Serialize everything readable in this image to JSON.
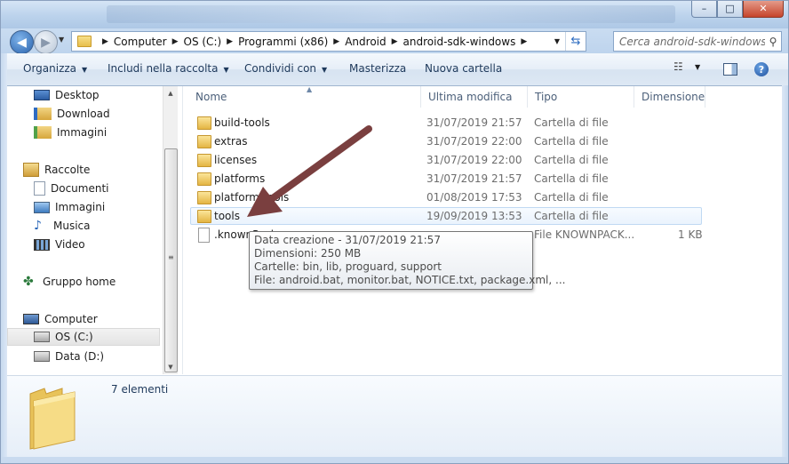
{
  "window": {
    "minimize": "–",
    "maximize": "□",
    "close": "✕"
  },
  "address": {
    "crumbs": [
      "Computer",
      "OS (C:)",
      "Programmi (x86)",
      "Android",
      "android-sdk-windows"
    ],
    "search_placeholder": "Cerca android-sdk-windows"
  },
  "toolbar": {
    "organize": "Organizza",
    "include": "Includi nella raccolta",
    "share": "Condividi con",
    "burn": "Masterizza",
    "new_folder": "Nuova cartella"
  },
  "nav": {
    "favorites": [
      "Desktop",
      "Download",
      "Immagini"
    ],
    "libraries_label": "Raccolte",
    "libraries": [
      "Documenti",
      "Immagini",
      "Musica",
      "Video"
    ],
    "homegroup": "Gruppo home",
    "computer": "Computer",
    "drives": [
      "OS (C:)",
      "Data (D:)"
    ]
  },
  "columns": {
    "name": "Nome",
    "modified": "Ultima modifica",
    "type": "Tipo",
    "size": "Dimensione"
  },
  "files": [
    {
      "name": "build-tools",
      "date": "31/07/2019 21:57",
      "type": "Cartella di file",
      "size": ""
    },
    {
      "name": "extras",
      "date": "31/07/2019 22:00",
      "type": "Cartella di file",
      "size": ""
    },
    {
      "name": "licenses",
      "date": "31/07/2019 22:00",
      "type": "Cartella di file",
      "size": ""
    },
    {
      "name": "platforms",
      "date": "31/07/2019 21:57",
      "type": "Cartella di file",
      "size": ""
    },
    {
      "name": "platform-tools",
      "date": "01/08/2019 17:53",
      "type": "Cartella di file",
      "size": ""
    },
    {
      "name": "tools",
      "date": "19/09/2019 13:53",
      "type": "Cartella di file",
      "size": ""
    },
    {
      "name": ".knownPackages",
      "date": "",
      "type": "File KNOWNPACK...",
      "size": "1 KB"
    }
  ],
  "tooltip": {
    "line1": "Data creazione - 31/07/2019 21:57",
    "line2": "Dimensioni: 250 MB",
    "line3": "Cartelle: bin, lib, proguard, support",
    "line4": "File: android.bat, monitor.bat, NOTICE.txt, package.xml, ..."
  },
  "details": {
    "count": "7 elementi"
  },
  "colors": {
    "arrow": "#7a3f3f",
    "accent": "#1e395b"
  }
}
